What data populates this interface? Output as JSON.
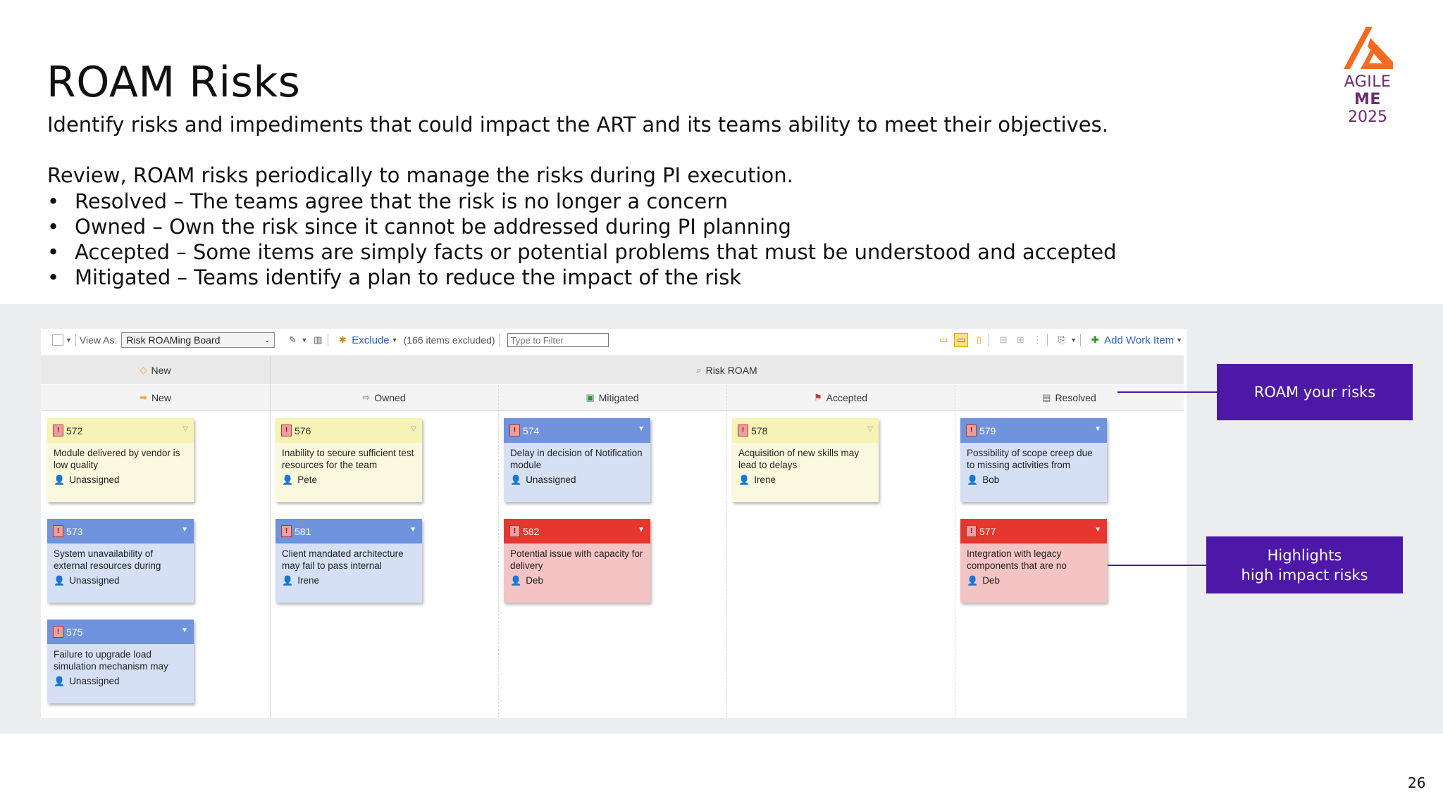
{
  "slide": {
    "title": "ROAM Risks",
    "subtitle": "Identify risks and impediments that could impact the ART and its teams ability to meet their objectives.",
    "review_line": "Review, ROAM risks periodically to manage the risks during PI execution.",
    "bullets": [
      "Resolved – The teams agree that the risk is no longer a concern",
      "Owned – Own the risk since it cannot be addressed during PI planning",
      "Accepted – Some items are simply facts or potential problems that must be understood and accepted",
      "Mitigated – Teams identify a plan to reduce the impact of the risk"
    ],
    "bullet_char": "•",
    "page_number": "26"
  },
  "logo": {
    "name_light": "AGILE ",
    "name_bold": "ME",
    "year": "2025",
    "color": "#f26b21"
  },
  "toolbar": {
    "view_as_label": "View As:",
    "view_as_value": "Risk ROAMing Board",
    "exclude_label": "Exclude",
    "excluded_count": "(166 items excluded)",
    "filter_placeholder": "Type to Filter",
    "add_work_item": "Add Work Item"
  },
  "board": {
    "group_new": "New",
    "group_roam": "Risk ROAM",
    "columns": [
      "New",
      "Owned",
      "Mitigated",
      "Accepted",
      "Resolved"
    ],
    "cards": {
      "c572": {
        "id": "572",
        "title": "Module delivered by vendor is low quality",
        "owner": "Unassigned"
      },
      "c573": {
        "id": "573",
        "title": "System unavailability of external resources during",
        "owner": "Unassigned"
      },
      "c575": {
        "id": "575",
        "title": "Failure to upgrade load simulation mechanism may",
        "owner": "Unassigned"
      },
      "c576": {
        "id": "576",
        "title": "Inability to secure sufficient test resources for the team",
        "owner": "Pete"
      },
      "c581": {
        "id": "581",
        "title": "Client mandated architecture may fail to pass internal",
        "owner": "Irene"
      },
      "c574": {
        "id": "574",
        "title": "Delay in decision of Notification module",
        "owner": "Unassigned"
      },
      "c582": {
        "id": "582",
        "title": "Potential issue with capacity for delivery",
        "owner": "Deb"
      },
      "c578": {
        "id": "578",
        "title": "Acquisition of new skills may lead to delays",
        "owner": "Irene"
      },
      "c579": {
        "id": "579",
        "title": "Possibility of scope creep due to missing activities from",
        "owner": "Bob"
      },
      "c577": {
        "id": "577",
        "title": "Integration with legacy components that are no",
        "owner": "Deb"
      }
    },
    "colors": {
      "yellow": "#f6f3b5",
      "blue": "#6f93dd",
      "red": "#e5372e"
    }
  },
  "callouts": {
    "roam": "ROAM your risks",
    "highlights_line1": "Highlights",
    "highlights_line2": "high impact risks",
    "color": "#4d17a8"
  }
}
